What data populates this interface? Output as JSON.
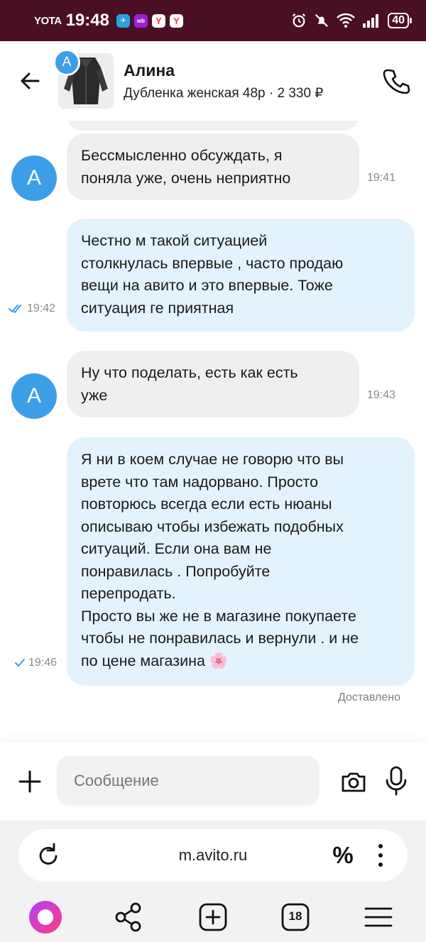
{
  "status_bar": {
    "carrier": "YOTA",
    "time": "19:48",
    "battery": "40",
    "app_icons": [
      {
        "name": "telegram-icon",
        "color": "#2aa0e0",
        "glyph": "✈"
      },
      {
        "name": "wildberries-icon",
        "color": "#9b1fd6",
        "glyph": "wb"
      },
      {
        "name": "yandex-icon-1",
        "color": "#ff3333",
        "glyph": "Y"
      },
      {
        "name": "yandex-icon-2",
        "color": "#ff3333",
        "glyph": "Y"
      }
    ]
  },
  "header": {
    "avatar_letter": "А",
    "contact_name": "Алина",
    "listing_title": "Дубленка женская 48р · 2 330 ₽"
  },
  "messages": [
    {
      "direction": "in",
      "text": "Бессмысленно обсуждать, я\nпоняла уже, очень неприятно",
      "time": "19:41",
      "avatar": "А"
    },
    {
      "direction": "out",
      "text": "Честно м такой ситуацией\nстолкнулась впервые , часто продаю\nвещи на авито и это впервые. Тоже\nситуация ге приятная",
      "time": "19:42",
      "status": "read"
    },
    {
      "direction": "in",
      "text": "Ну что поделать, есть как есть\nуже",
      "time": "19:43",
      "avatar": "А"
    },
    {
      "direction": "out",
      "text": "Я ни в коем случае не говорю что вы\nврете что там надорвано. Просто\nповторюсь всегда если есть нюаны\nописываю чтобы избежать подобных\nситуаций.  Если она вам не\nпонравилась . Попробуйте\nперепродать.\nПросто вы же не в магазине покупаете\nчтобы не понравилась и вернули . и не\nпо цене магазина 🌸",
      "time": "19:46",
      "status": "sent"
    }
  ],
  "delivery_status": "Доставлено",
  "composer": {
    "placeholder": "Сообщение"
  },
  "browser": {
    "url": "m.avito.ru",
    "tabs_count": "18",
    "percent_label": "%"
  },
  "colors": {
    "status_bar_bg": "#4a0f25",
    "avatar_blue": "#3d9ee8",
    "incoming_bubble": "#efefef",
    "outgoing_bubble": "#e2f3fd",
    "tick_blue": "#3d9ee8",
    "alice_gradient_start": "#b43dff",
    "alice_gradient_end": "#ff3d7f"
  }
}
